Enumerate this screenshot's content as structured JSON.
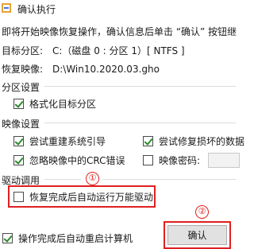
{
  "window": {
    "title": "确认执行"
  },
  "description": "即将开始映像恢复操作，确认信息后单击 “确认” 按钮继",
  "info": {
    "target_label": "目标分区:",
    "target_value": "C:（磁盘 0 : 分区 1）[ NTFS ]",
    "image_label": "恢复映像:",
    "image_value": "D:\\Win10.2020.03.gho"
  },
  "partition_settings": {
    "header": "分区设置",
    "format_label": "格式化目标分区",
    "format_checked": true
  },
  "image_settings": {
    "header": "映像设置",
    "rebuild_boot_label": "尝试重建系统引导",
    "rebuild_boot_checked": true,
    "repair_damaged_label": "尝试修复损坏的数据",
    "repair_damaged_checked": true,
    "ignore_crc_label": "忽略映像中的CRC错误",
    "ignore_crc_checked": true,
    "image_password_label": "映像密码:",
    "image_password_checked": false,
    "image_password_value": ""
  },
  "driver": {
    "header": "驱动调用",
    "auto_driver_label": "恢复完成后自动运行万能驱动",
    "auto_driver_checked": false
  },
  "footer": {
    "auto_restart_label": "操作完成后自动重启计算机",
    "auto_restart_checked": true,
    "confirm_label": "确认"
  },
  "annotations": {
    "marker_1": "①",
    "marker_2": "②",
    "accent_color": "#e02020"
  },
  "colors": {
    "check_color": "#2b8a2b",
    "button_bg": "#e1e1e1"
  }
}
